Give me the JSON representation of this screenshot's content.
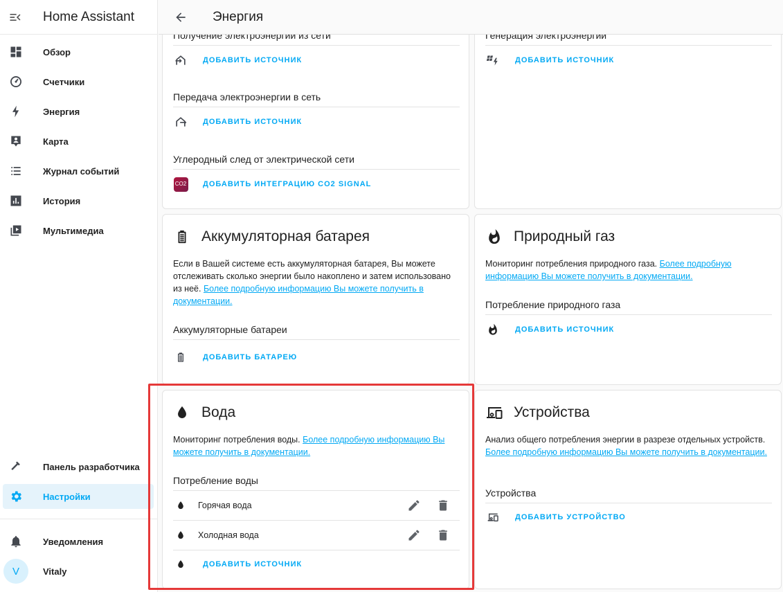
{
  "app": {
    "title": "Home Assistant"
  },
  "sidebar": {
    "items": [
      {
        "label": "Обзор",
        "icon": "dashboard-icon"
      },
      {
        "label": "Счетчики",
        "icon": "gauge-icon"
      },
      {
        "label": "Энергия",
        "icon": "lightning-icon"
      },
      {
        "label": "Карта",
        "icon": "map-person-icon"
      },
      {
        "label": "Журнал событий",
        "icon": "list-icon"
      },
      {
        "label": "История",
        "icon": "chart-box-icon"
      },
      {
        "label": "Мультимедиа",
        "icon": "media-icon"
      }
    ],
    "bottom": {
      "developer": "Панель разработчика",
      "settings": "Настройки",
      "notifications": "Уведомления",
      "user": "Vitaly",
      "avatar_letter": "V"
    }
  },
  "topbar": {
    "title": "Энергия"
  },
  "grid_card": {
    "consumption_title": "Получение электроэнергии из сети",
    "consumption_add": "Добавить источник",
    "return_title": "Передача электроэнергии в сеть",
    "return_add": "Добавить источник",
    "co2_title": "Углеродный след от электрической сети",
    "co2_add": "Добавить интеграцию CO2 Signal",
    "co2_logo": "CO2"
  },
  "solar_card": {
    "section_title": "Генерация электроэнергии",
    "add": "Добавить источник"
  },
  "battery_card": {
    "title": "Аккумуляторная батарея",
    "desc": "Если в Вашей системе есть аккумуляторная батарея, Вы можете отслеживать сколько энергии было накоплено и затем использовано из неё.",
    "link": "Более подробную информацию Вы можете получить в документации.",
    "section_title": "Аккумуляторные батареи",
    "add": "Добавить батарею"
  },
  "gas_card": {
    "title": "Природный газ",
    "desc": "Мониторинг потребления природного газа.",
    "link": "Более подробную информацию Вы можете получить в документации.",
    "section_title": "Потребление природного газа",
    "add": "Добавить источник"
  },
  "water_card": {
    "title": "Вода",
    "desc": "Мониторинг потребления воды.",
    "link": "Более подробную информацию Вы можете получить в документации.",
    "section_title": "Потребление воды",
    "items": [
      {
        "label": "Горячая вода"
      },
      {
        "label": "Холодная вода"
      }
    ],
    "add": "Добавить источник"
  },
  "devices_card": {
    "title": "Устройства",
    "desc": "Анализ общего потребления энергии в разрезе отдельных устройств.",
    "link": "Более подробную информацию Вы можете получить в документации.",
    "section_title": "Устройства",
    "add": "Добавить устройство"
  },
  "colors": {
    "accent": "#03a9f4",
    "icon": "#44484f",
    "highlight": "#e53939"
  }
}
